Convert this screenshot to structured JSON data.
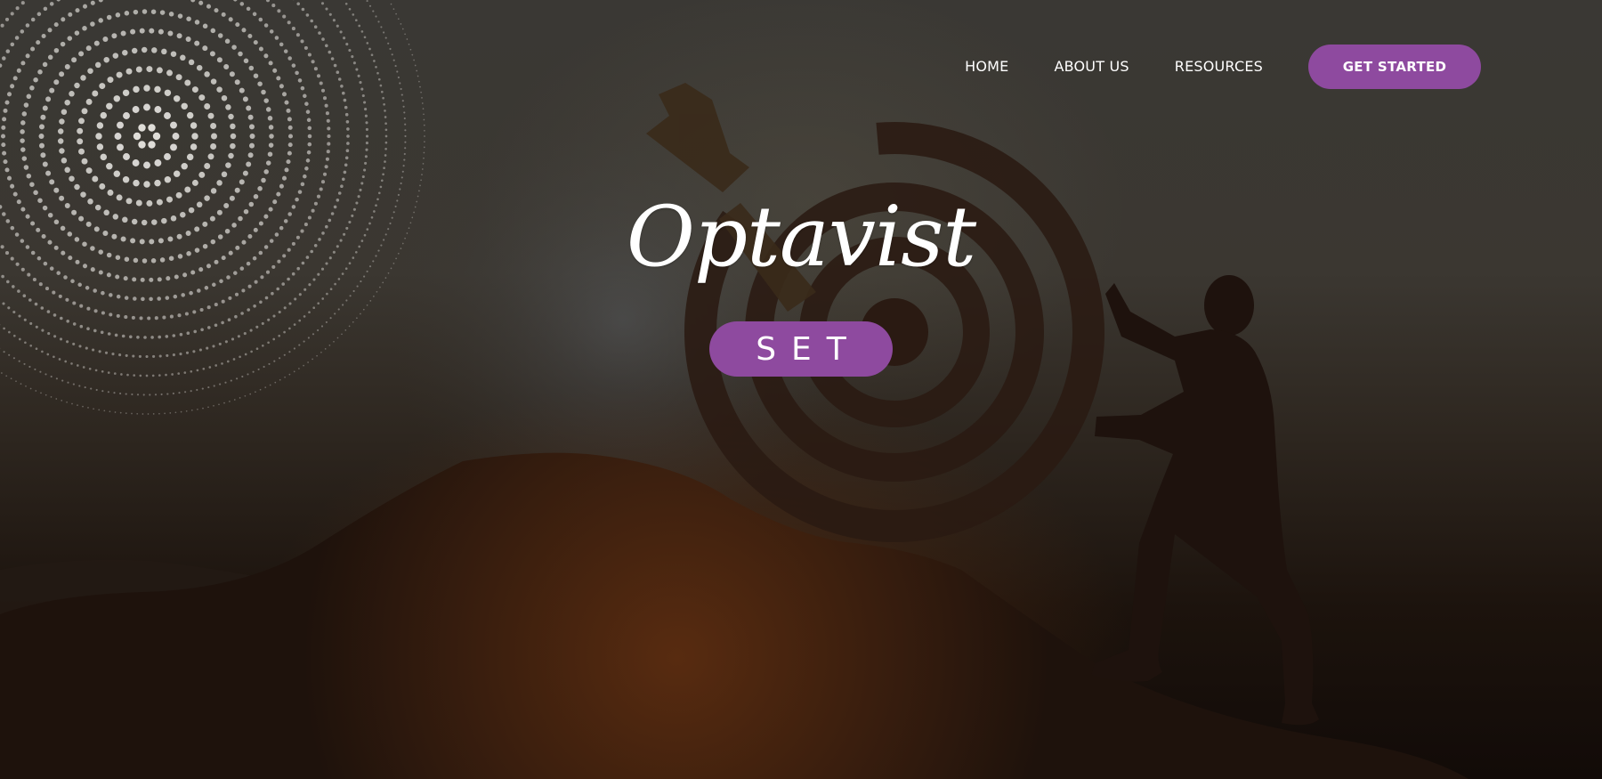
{
  "nav": {
    "items": [
      {
        "label": "HOME"
      },
      {
        "label": "ABOUT US"
      },
      {
        "label": "RESOURCES"
      }
    ],
    "cta_label": "GET STARTED"
  },
  "hero": {
    "brand_name": "Optavist",
    "badge_label": "SET",
    "background_scene": "silhouette of a man pushing a giant archery target up a hill at sunset"
  },
  "colors": {
    "accent": "#8e4a9f",
    "text": "#ffffff"
  }
}
